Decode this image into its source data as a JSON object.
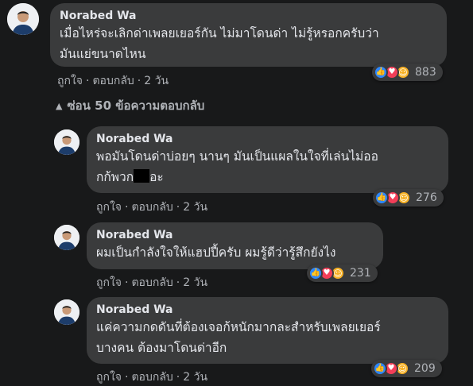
{
  "action_labels": {
    "like": "ถูกใจ",
    "reply": "ตอบกลับ"
  },
  "reaction_colors": {
    "like": "#2d88ff",
    "love": "#f33e58",
    "care": "#f7b125"
  },
  "main_comment": {
    "author": "Norabed Wa",
    "lines": [
      "เมื่อไหร่จะเลิกด่าเพลยเยอร์กัน ไม่มาโดนด่า ไม่รู้หรอกครับว่า",
      "มันแย่ขนาดไหน"
    ],
    "time": "2 วัน",
    "reaction_count": "883"
  },
  "hide_replies": {
    "label": "ซ่อน 50 ข้อความตอบกลับ"
  },
  "replies": [
    {
      "author": "Norabed Wa",
      "line1": "พอมันโดนด่าบ่อยๆ นานๆ มันเป็นแผลในใจที่เล่นไม่ออ",
      "line2_before": "กก้พวก",
      "line2_after": "อะ",
      "time": "2 วัน",
      "reaction_count": "276"
    },
    {
      "author": "Norabed Wa",
      "line1": "ผมเป็นกำลังใจให้แฮปปี้ครับ ผมรู้ดีว่ารู้สึกยังไง",
      "time": "2 วัน",
      "reaction_count": "231"
    },
    {
      "author": "Norabed Wa",
      "line1": "แค่ความกดดันที่ต้องเจอก้หนักมากละสำหรับเพลยเยอร์",
      "line2": "บางคน ต้องมาโดนด่าอีก",
      "time": "2 วัน",
      "reaction_count": "209"
    }
  ]
}
